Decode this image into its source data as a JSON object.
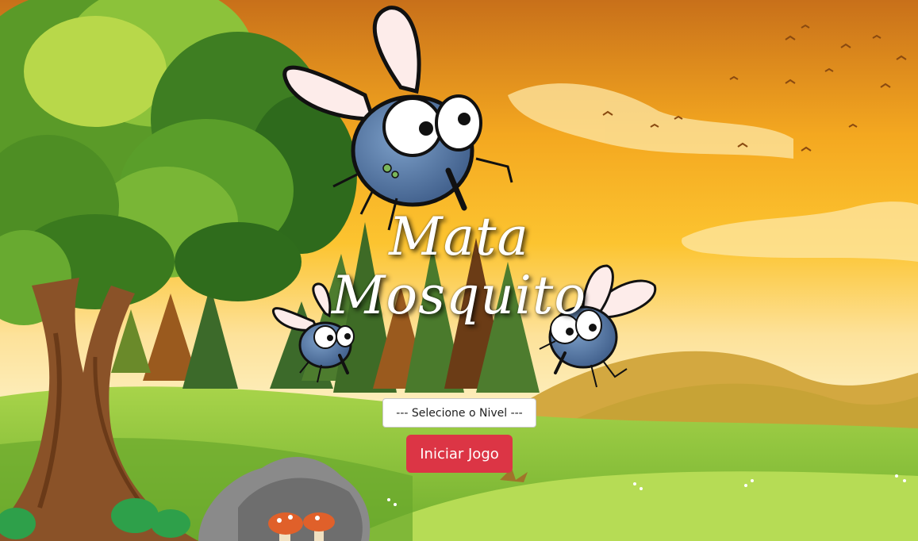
{
  "game": {
    "title_line1": "Mata",
    "title_line2": "Mosquito",
    "level_select": {
      "selected": "--- Selecione o Nivel ---",
      "options": [
        "--- Selecione o Nivel ---"
      ]
    },
    "start_button": "Iniciar Jogo"
  },
  "colors": {
    "sky_top": "#e8881a",
    "sky_mid": "#fbbf2a",
    "sky_low": "#fde9a8",
    "grass": "#8ec63f",
    "button": "#dc3545",
    "title_text": "#ffffff"
  }
}
